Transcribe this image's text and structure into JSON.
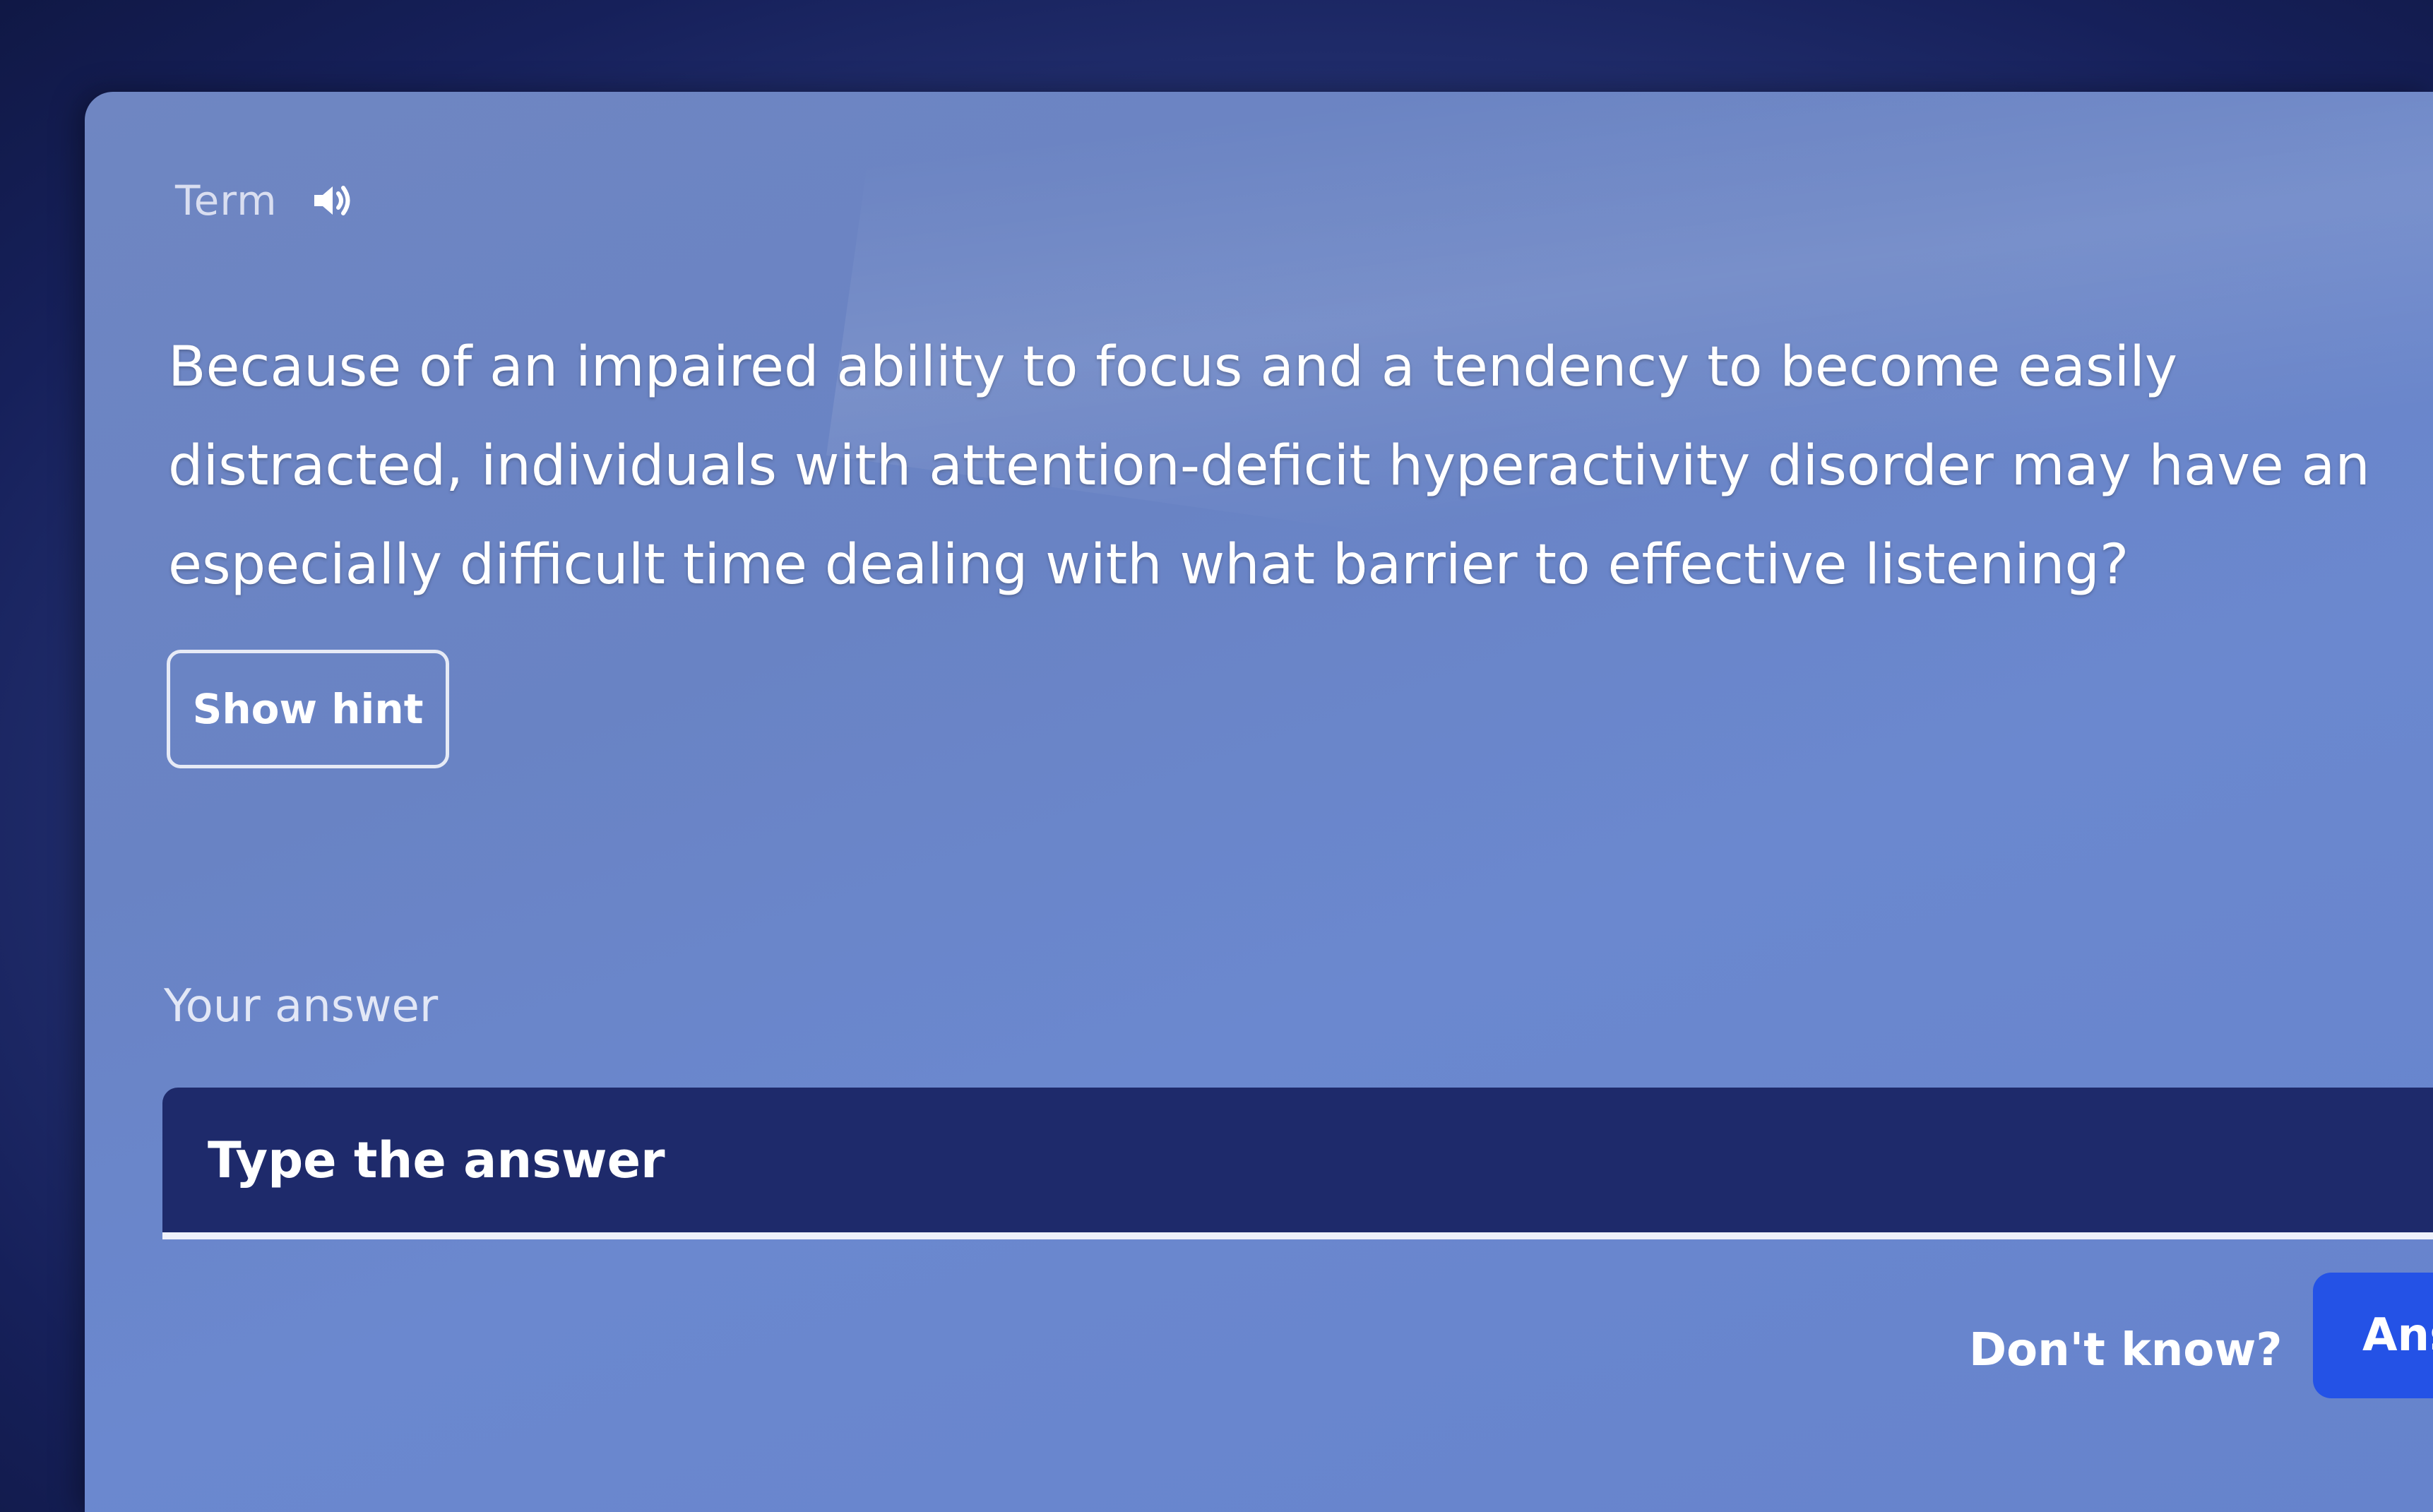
{
  "card": {
    "term_label": "Term",
    "speaker_icon": "speaker-icon",
    "question": "Because of an impaired ability to focus and a tendency to become easily distracted, individuals with attention-deficit hyperactivity disorder may have an especially difficult time dealing with what barrier to effective listening?",
    "hint_label": "Show hint",
    "answer_label": "Your answer",
    "answer_placeholder": "Type the answer",
    "answer_value": "",
    "dont_know_label": "Don't know?",
    "answer_button_label": "Ans"
  },
  "colors": {
    "card_background": "#6b86c8",
    "input_background": "#1e2a6b",
    "answer_button": "#2452e6",
    "text": "#ffffff"
  }
}
